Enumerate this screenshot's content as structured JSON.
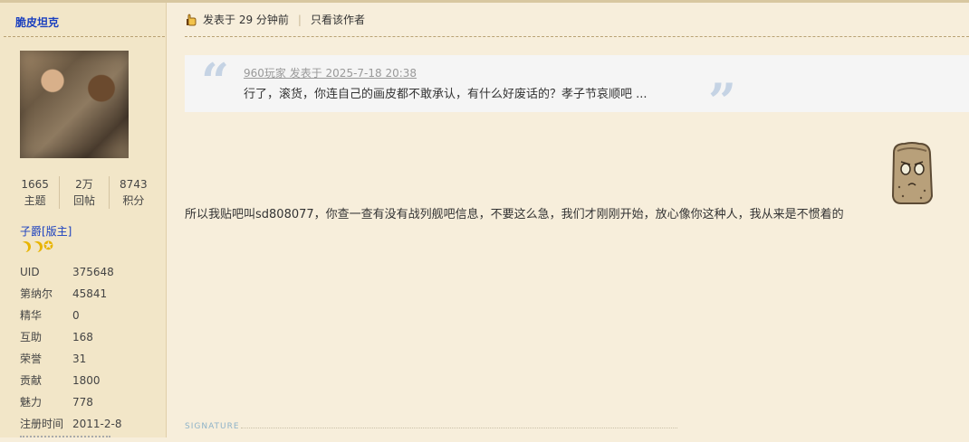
{
  "sidebar": {
    "username": "脆皮坦克",
    "stats": [
      {
        "num": "1665",
        "label": "主题"
      },
      {
        "num": "2万",
        "label": "回帖"
      },
      {
        "num": "8743",
        "label": "积分"
      }
    ],
    "rank": "子爵[版主]",
    "info": [
      {
        "k": "UID",
        "v": "375648"
      },
      {
        "k": "第纳尔",
        "v": "45841"
      },
      {
        "k": "精华",
        "v": "0"
      },
      {
        "k": "互助",
        "v": "168"
      },
      {
        "k": "荣誉",
        "v": "31"
      },
      {
        "k": "贡献",
        "v": "1800"
      },
      {
        "k": "魅力",
        "v": "778"
      },
      {
        "k": "注册时间",
        "v": "2011-2-8"
      }
    ]
  },
  "post": {
    "posted_at": "发表于 29 分钟前",
    "separator": "|",
    "only_author": "只看该作者",
    "quote": {
      "header": "960玩家 发表于 2025-7-18 20:38",
      "text": "行了，滚货，你连自己的画皮都不敢承认，有什么好废话的？孝子节哀顺吧 ..."
    },
    "body": "所以我贴吧叫sd808077，你查一查有没有战列舰吧信息，不要这么急，我们才刚刚开始，放心像你这种人，我从来是不惯着的",
    "signature_label": "SIGNATURE"
  },
  "colors": {
    "background": "#f7eedb",
    "sidebar": "#f2e6c8",
    "link": "#1a3fbf",
    "quote_mark": "#c5d3e4"
  }
}
